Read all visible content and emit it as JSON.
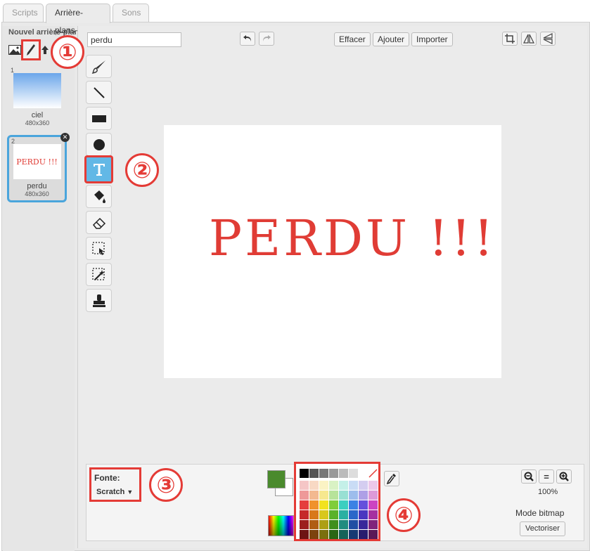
{
  "tabs": [
    {
      "label": "Scripts"
    },
    {
      "label": "Arrière-plans"
    },
    {
      "label": "Sons"
    }
  ],
  "new_backdrop": {
    "title": "Nouvel arrière-plan:",
    "icons": [
      "image-library-icon",
      "paint-brush-icon",
      "upload-icon"
    ]
  },
  "backdrops": [
    {
      "number": "1",
      "name": "ciel",
      "size": "480x360"
    },
    {
      "number": "2",
      "name": "perdu",
      "size": "480x360",
      "thumb_text": "PERDU !!!"
    }
  ],
  "editor": {
    "costume_name": "perdu",
    "buttons": {
      "clear": "Effacer",
      "add": "Ajouter",
      "import": "Importer"
    },
    "canvas_text": "PERDU !!!",
    "canvas_text_color": "#e03c35"
  },
  "tools": [
    "brush-icon",
    "line-icon",
    "rectangle-icon",
    "ellipse-icon",
    "text-icon",
    "fill-icon",
    "eraser-icon",
    "select-icon",
    "magic-select-icon",
    "stamp-icon"
  ],
  "font": {
    "label": "Fonte:",
    "value": "Scratch"
  },
  "colors": {
    "primary": "#4a8a2d",
    "secondary": "#ffffff",
    "annotation": "#e43b36",
    "selection": "#4aa5dc"
  },
  "palette": [
    [
      "#000000",
      "#555555",
      "#777777",
      "#999999",
      "#bbbbbb",
      "#dddddd",
      "#ffffff",
      "none"
    ],
    [
      "#f5c6c6",
      "#f8d9c4",
      "#fbf3c4",
      "#d9f2c4",
      "#c4f0e8",
      "#c9dcf5",
      "#d4cdf0",
      "#ecc8ea"
    ],
    [
      "#ee9999",
      "#f3b990",
      "#f6e88f",
      "#b7e39a",
      "#98e0d3",
      "#9dbdec",
      "#aea0e6",
      "#dd9ad8"
    ],
    [
      "#e53d3d",
      "#f0922b",
      "#f2e21e",
      "#7fcd3a",
      "#3ccfc0",
      "#3b82e4",
      "#6550dc",
      "#cc43c2"
    ],
    [
      "#c52a2a",
      "#d8781b",
      "#d8c71c",
      "#5ab22a",
      "#2ab0a2",
      "#2a67c9",
      "#4a36c0",
      "#a630a0"
    ],
    [
      "#9c1e1e",
      "#b05d14",
      "#ad9f14",
      "#3f8f1d",
      "#1f8c80",
      "#1f4ea3",
      "#38289a",
      "#80237b"
    ],
    [
      "#6e1414",
      "#7c420e",
      "#7a700e",
      "#2a6614",
      "#156359",
      "#163973",
      "#281c6e",
      "#5a1857"
    ]
  ],
  "zoom": {
    "minus": "−",
    "reset": "=",
    "plus": "+",
    "level": "100%"
  },
  "mode": {
    "label": "Mode bitmap",
    "convert": "Vectoriser"
  },
  "annotations": [
    "①",
    "②",
    "③",
    "④"
  ]
}
